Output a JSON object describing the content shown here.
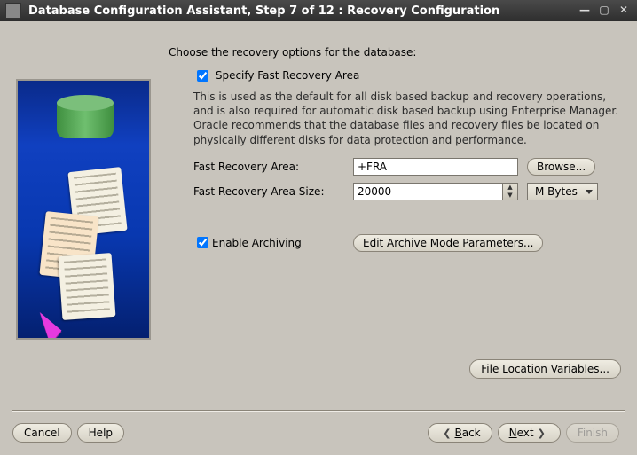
{
  "window": {
    "title": "Database Configuration Assistant, Step 7 of 12 : Recovery Configuration"
  },
  "content": {
    "intro": "Choose the recovery options for the database:",
    "recovery": {
      "checkbox_label": "Specify Fast Recovery Area",
      "checked": true,
      "description": "This is used as the default for all disk based backup and recovery operations, and is also required for automatic disk based backup using Enterprise Manager. Oracle recommends that the database files and recovery files be located on physically different disks for data protection and performance.",
      "fra_label": "Fast Recovery Area:",
      "fra_value": "+FRA",
      "browse_label": "Browse...",
      "fra_size_label": "Fast Recovery Area Size:",
      "fra_size_value": "20000",
      "fra_size_unit": "M Bytes"
    },
    "archive": {
      "checkbox_label": "Enable Archiving",
      "checked": true,
      "button_label": "Edit Archive Mode Parameters..."
    },
    "file_loc_button": "File Location Variables..."
  },
  "buttons": {
    "cancel": "Cancel",
    "help": "Help",
    "back": "Back",
    "next": "Next",
    "finish": "Finish"
  }
}
